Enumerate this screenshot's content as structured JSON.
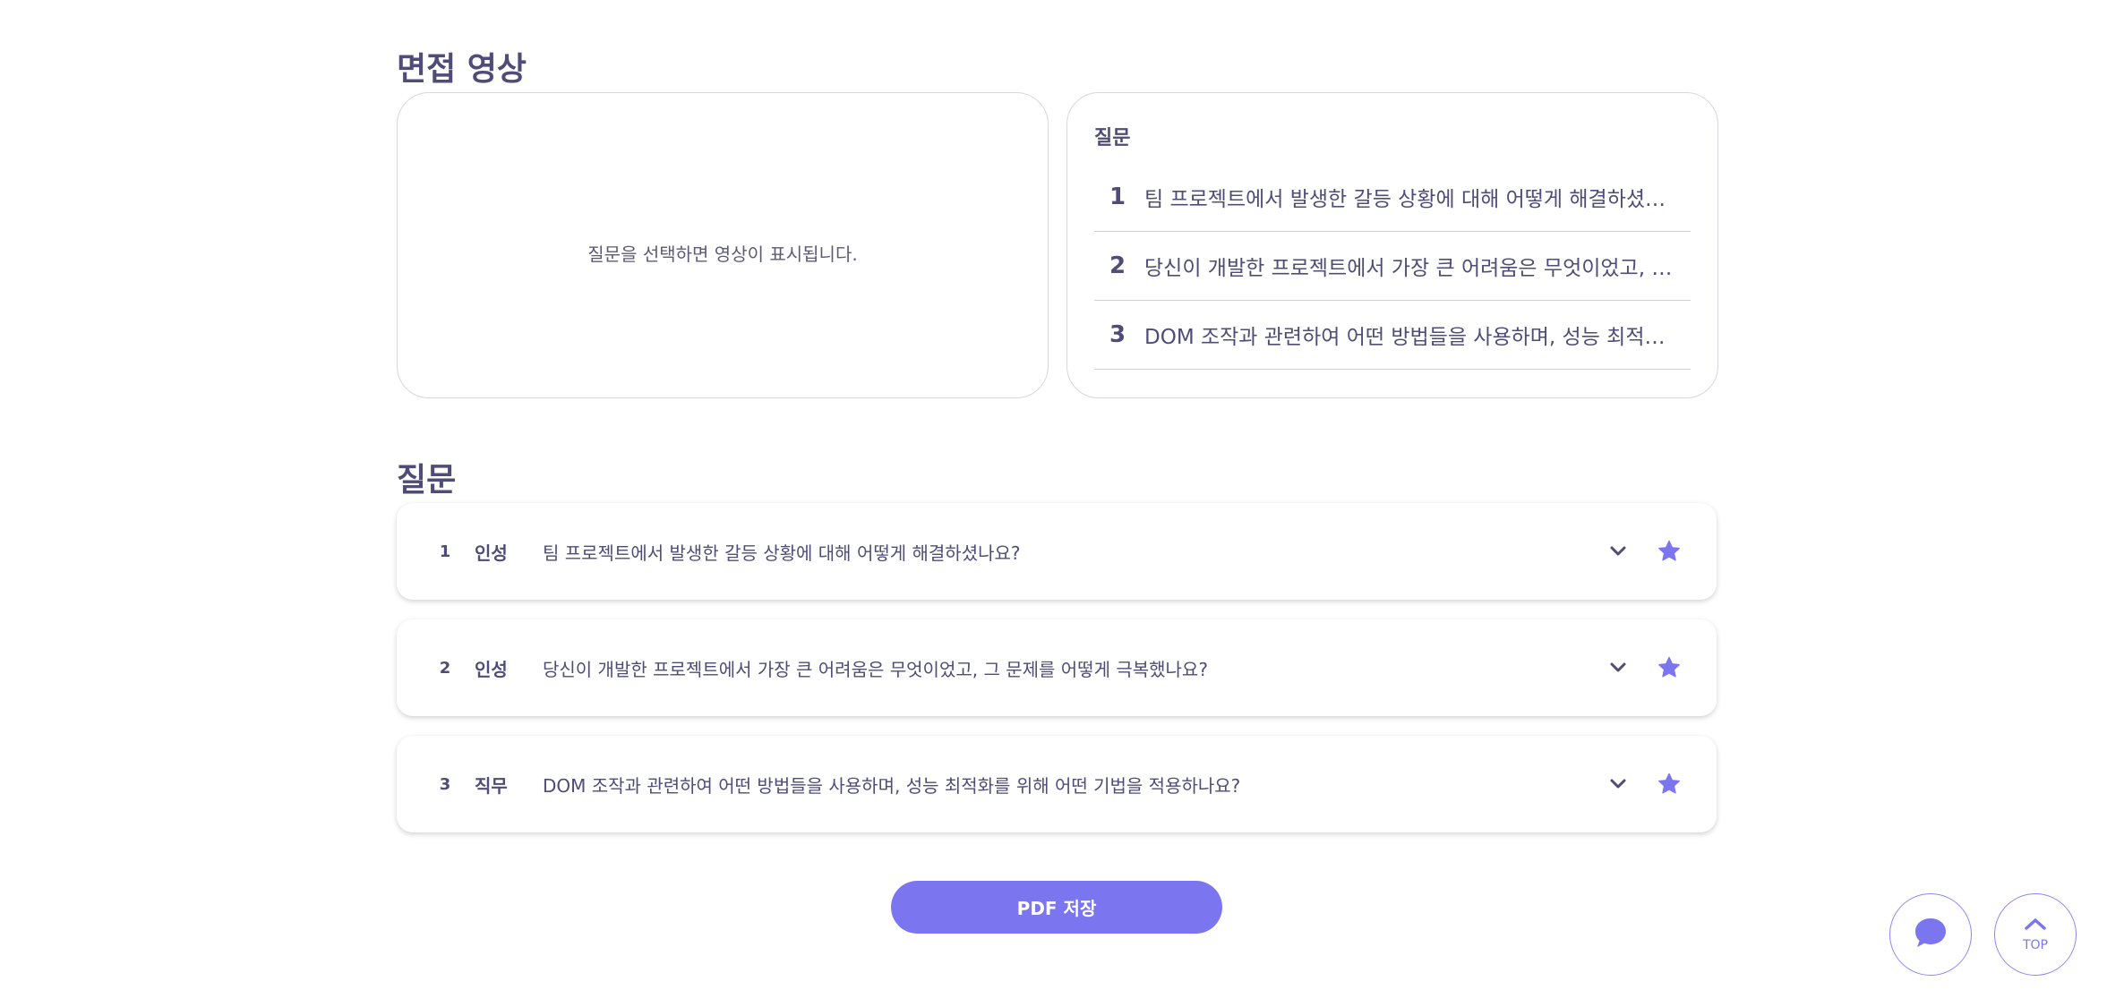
{
  "video_section": {
    "title": "면접 영상",
    "placeholder": "질문을 선택하면 영상이 표시됩니다."
  },
  "question_list_panel": {
    "heading": "질문",
    "items": [
      {
        "num": "1",
        "text": "팀 프로젝트에서 발생한 갈등 상황에 대해 어떻게 해결하셨나요?"
      },
      {
        "num": "2",
        "text": "당신이 개발한 프로젝트에서 가장 큰 어려움은 무엇이었고, 그 문제를 어떻게 극복했나요?"
      },
      {
        "num": "3",
        "text": "DOM 조작과 관련하여 어떤 방법들을 사용하며, 성능 최적화를 위해 어떤 기법을 적용하나요?"
      }
    ]
  },
  "questions_section": {
    "title": "질문",
    "items": [
      {
        "num": "1",
        "category": "인성",
        "text": "팀 프로젝트에서 발생한 갈등 상황에 대해 어떻게 해결하셨나요?"
      },
      {
        "num": "2",
        "category": "인성",
        "text": "당신이 개발한 프로젝트에서 가장 큰 어려움은 무엇이었고, 그 문제를 어떻게 극복했나요?"
      },
      {
        "num": "3",
        "category": "직무",
        "text": "DOM 조작과 관련하여 어떤 방법들을 사용하며, 성능 최적화를 위해 어떤 기법을 적용하나요?"
      }
    ]
  },
  "pdf_button_label": "PDF 저장",
  "floating": {
    "chat_icon": "chat-bubble-icon",
    "top_label": "TOP"
  },
  "colors": {
    "accent": "#7b76f0",
    "text": "#4f4c78",
    "border": "#d7d7dc"
  }
}
